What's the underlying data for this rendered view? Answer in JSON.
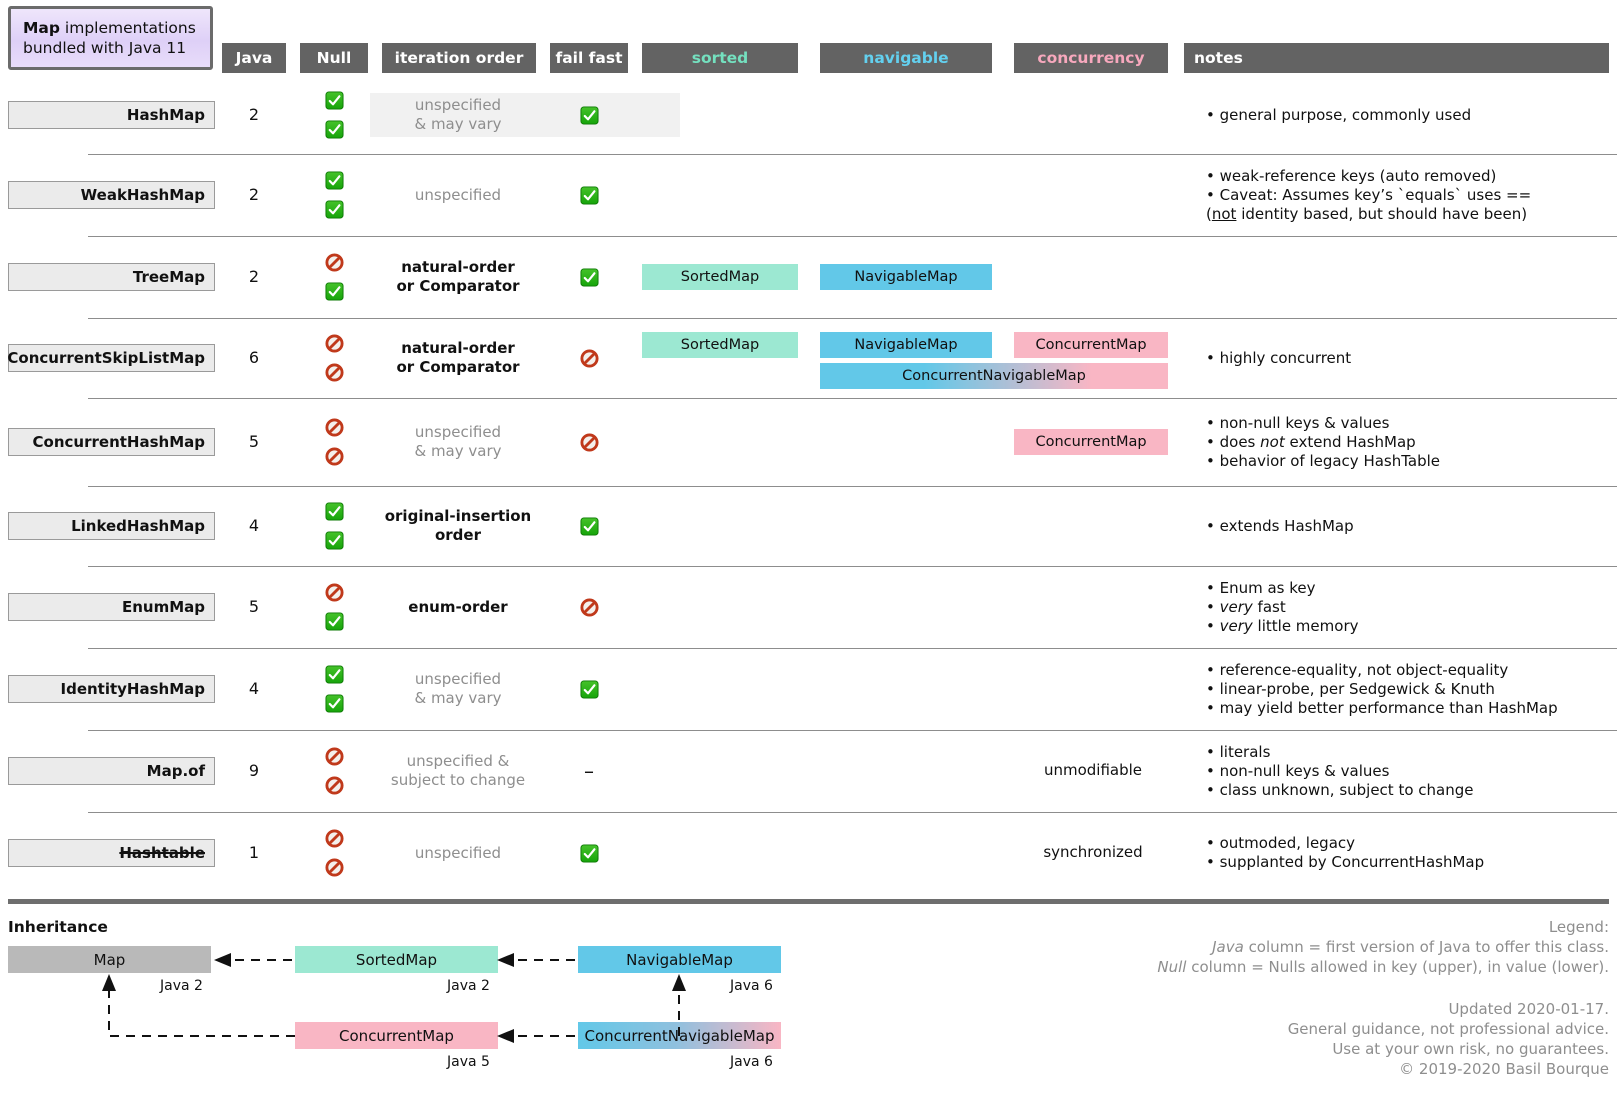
{
  "header": {
    "title_bold": "Map",
    "title_rest": " implementations",
    "title_line2": "bundled with Java 11",
    "columns": [
      {
        "key": "java",
        "label": "Java"
      },
      {
        "key": "null",
        "label": "Null"
      },
      {
        "key": "iteration_order",
        "label": "iteration order"
      },
      {
        "key": "fail_fast",
        "label": "fail fast"
      },
      {
        "key": "sorted",
        "label": "sorted",
        "color": "#74e0bf"
      },
      {
        "key": "navigable",
        "label": "navigable",
        "color": "#63d0ef"
      },
      {
        "key": "concurrency",
        "label": "concurrency",
        "color": "#f7a8bd"
      },
      {
        "key": "notes",
        "label": "notes"
      }
    ]
  },
  "rows": [
    {
      "name": "HashMap",
      "struck": false,
      "java": "2",
      "null_key": "check",
      "null_value": "check",
      "iteration_order": [
        "unspecified",
        "& may vary"
      ],
      "iteration_strong": false,
      "fail_fast": "check",
      "sorted": null,
      "navigable": null,
      "concurrency_badge": null,
      "concurrency_text": "",
      "span_badge": null,
      "notes": [
        "• general purpose, commonly used"
      ]
    },
    {
      "name": "WeakHashMap",
      "struck": false,
      "java": "2",
      "null_key": "check",
      "null_value": "check",
      "iteration_order": [
        "unspecified"
      ],
      "iteration_strong": false,
      "fail_fast": "check",
      "sorted": null,
      "navigable": null,
      "concurrency_badge": null,
      "concurrency_text": "",
      "span_badge": null,
      "notes": [
        "• weak-reference keys (auto removed)",
        "• Caveat: Assumes key’s `equals` uses ==",
        "(not identity based, but should have been)"
      ]
    },
    {
      "name": "TreeMap",
      "struck": false,
      "java": "2",
      "null_key": "ban",
      "null_value": "check",
      "iteration_order": [
        "natural-order",
        "or Comparator"
      ],
      "iteration_strong": true,
      "fail_fast": "check",
      "sorted": "SortedMap",
      "navigable": "NavigableMap",
      "concurrency_badge": null,
      "concurrency_text": "",
      "span_badge": null,
      "notes": []
    },
    {
      "name": "ConcurrentSkipListMap",
      "struck": false,
      "java": "6",
      "null_key": "ban",
      "null_value": "ban",
      "iteration_order": [
        "natural-order",
        "or Comparator"
      ],
      "iteration_strong": true,
      "fail_fast": "ban",
      "sorted": "SortedMap",
      "navigable": "NavigableMap",
      "concurrency_badge": "ConcurrentMap",
      "concurrency_text": "",
      "span_badge": "ConcurrentNavigableMap",
      "notes": [
        "• highly concurrent"
      ]
    },
    {
      "name": "ConcurrentHashMap",
      "struck": false,
      "java": "5",
      "null_key": "ban",
      "null_value": "ban",
      "iteration_order": [
        "unspecified",
        "& may vary"
      ],
      "iteration_strong": false,
      "fail_fast": "ban",
      "sorted": null,
      "navigable": null,
      "concurrency_badge": "ConcurrentMap",
      "concurrency_text": "",
      "span_badge": null,
      "notes": [
        "• non-null keys & values",
        "• does not extend HashMap",
        "• behavior of legacy HashTable"
      ]
    },
    {
      "name": "LinkedHashMap",
      "struck": false,
      "java": "4",
      "null_key": "check",
      "null_value": "check",
      "iteration_order": [
        "original-insertion",
        "order"
      ],
      "iteration_strong": true,
      "fail_fast": "check",
      "sorted": null,
      "navigable": null,
      "concurrency_badge": null,
      "concurrency_text": "",
      "span_badge": null,
      "notes": [
        "• extends HashMap"
      ]
    },
    {
      "name": "EnumMap",
      "struck": false,
      "java": "5",
      "null_key": "ban",
      "null_value": "check",
      "iteration_order": [
        "enum-order"
      ],
      "iteration_strong": true,
      "fail_fast": "ban",
      "sorted": null,
      "navigable": null,
      "concurrency_badge": null,
      "concurrency_text": "",
      "span_badge": null,
      "notes": [
        "• Enum as key",
        "• very fast",
        "• very little memory"
      ]
    },
    {
      "name": "IdentityHashMap",
      "struck": false,
      "java": "4",
      "null_key": "check",
      "null_value": "check",
      "iteration_order": [
        "unspecified",
        "& may vary"
      ],
      "iteration_strong": false,
      "fail_fast": "check",
      "sorted": null,
      "navigable": null,
      "concurrency_badge": null,
      "concurrency_text": "",
      "span_badge": null,
      "notes": [
        "• reference-equality, not object-equality",
        "• linear-probe, per Sedgewick & Knuth",
        "• may yield better performance than HashMap"
      ]
    },
    {
      "name": "Map.of",
      "struck": false,
      "java": "9",
      "null_key": "ban",
      "null_value": "ban",
      "iteration_order": [
        "unspecified &",
        "subject to change"
      ],
      "iteration_strong": false,
      "fail_fast": "dash",
      "sorted": null,
      "navigable": null,
      "concurrency_badge": null,
      "concurrency_text": "unmodifiable",
      "span_badge": null,
      "notes": [
        "• literals",
        "• non-null keys & values",
        "• class unknown, subject to change"
      ]
    },
    {
      "name": "Hashtable",
      "struck": true,
      "java": "1",
      "null_key": "ban",
      "null_value": "ban",
      "iteration_order": [
        "unspecified"
      ],
      "iteration_strong": false,
      "fail_fast": "check",
      "sorted": null,
      "navigable": null,
      "concurrency_badge": null,
      "concurrency_text": "synchronized",
      "span_badge": null,
      "notes": [
        "• outmoded, legacy",
        "• supplanted by ConcurrentHashMap"
      ]
    }
  ],
  "inheritance": {
    "title": "Inheritance",
    "nodes": [
      {
        "id": "map",
        "label": "Map",
        "version": "Java 2"
      },
      {
        "id": "sort",
        "label": "SortedMap",
        "version": "Java 2"
      },
      {
        "id": "nav",
        "label": "NavigableMap",
        "version": "Java 6"
      },
      {
        "id": "conc",
        "label": "ConcurrentMap",
        "version": "Java 5"
      },
      {
        "id": "cnav",
        "label": "ConcurrentNavigableMap",
        "version": "Java 6"
      }
    ]
  },
  "legend": {
    "heading": "Legend:",
    "line_java_em": "Java",
    "line_java_rest": " column = first version of Java to offer this class.",
    "line_null_em": "Null",
    "line_null_rest": " column = Nulls allowed in key (upper), in value (lower).",
    "updated": "Updated 2020-01-17.",
    "guidance": "General guidance, not professional advice.",
    "risk": "Use at your own risk, no guarantees.",
    "copyright": "© 2019-2020 Basil Bourque"
  },
  "icons": {
    "check": "check-icon",
    "ban": "ban-icon",
    "dash": "dash-icon"
  },
  "colors": {
    "sorted": "#9ce8d2",
    "navigable": "#62c8e8",
    "concurrency": "#f9b6c4",
    "header_bg": "#636363",
    "name_bg": "#ebebeb"
  }
}
